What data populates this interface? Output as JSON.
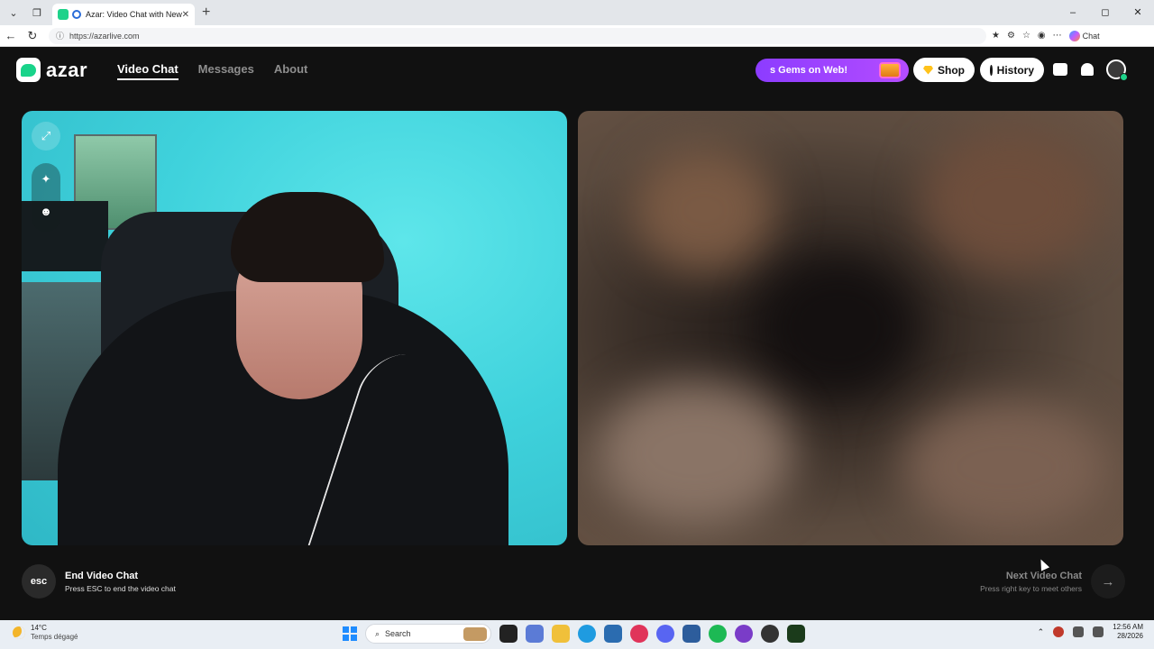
{
  "browser": {
    "tab_title": "Azar: Video Chat with New Pe",
    "url": "https://azarlive.com",
    "copilot_label": "Chat",
    "window_controls": [
      "–",
      "◻",
      "✕"
    ]
  },
  "nav": {
    "logo_text": "azar",
    "menu": [
      {
        "label": "Video Chat",
        "active": true
      },
      {
        "label": "Messages",
        "active": false
      },
      {
        "label": "About",
        "active": false
      }
    ],
    "gems_banner": "s Gems on Web!",
    "shop_label": "Shop",
    "history_label": "History"
  },
  "video": {
    "left_tools": [
      "expand-icon",
      "magic-wand-icon",
      "sticker-icon"
    ]
  },
  "controls": {
    "esc_key": "esc",
    "end_title": "End Video Chat",
    "end_sub": "Press ESC to end the video chat",
    "next_title": "Next Video Chat",
    "next_sub": "Press right key to meet others",
    "next_arrow": "→"
  },
  "taskbar": {
    "temperature": "14°C",
    "weather_desc": "Temps dégagé",
    "search_placeholder": "Search",
    "time": "12:56 AM",
    "date": "28/2026"
  },
  "colors": {
    "brand_green": "#1ed28a",
    "gems_purple": "#8c3cff",
    "page_bg": "#111111"
  }
}
